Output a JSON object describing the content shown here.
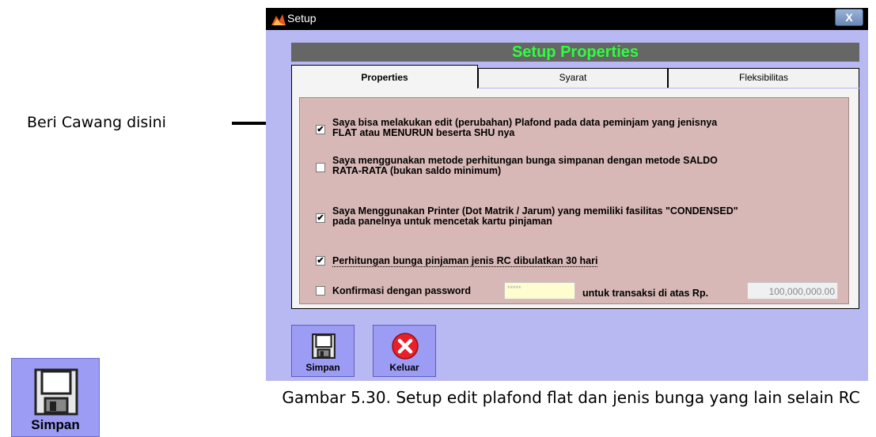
{
  "annotation": {
    "label": "Beri Cawang disini"
  },
  "big_button": {
    "label": "Simpan",
    "icon": "floppy-disk-icon"
  },
  "caption": "Gambar 5.30. Setup edit plafond flat dan jenis bunga yang lain selain RC",
  "window": {
    "title": "Setup",
    "close_label": "X",
    "header": "Setup Properties",
    "tabs": [
      {
        "label": "Properties",
        "active": true
      },
      {
        "label": "Syarat",
        "active": false
      },
      {
        "label": "Fleksibilitas",
        "active": false
      }
    ],
    "options": [
      {
        "checked": true,
        "line1": "Saya bisa melakukan edit (perubahan) Plafond pada data peminjam yang jenisnya",
        "line2": "FLAT atau MENURUN beserta SHU nya"
      },
      {
        "checked": false,
        "line1": "Saya menggunakan metode perhitungan bunga simpanan dengan metode SALDO",
        "line2": "RATA-RATA (bukan saldo minimum)"
      },
      {
        "checked": true,
        "line1": "Saya Menggunakan Printer (Dot Matrik / Jarum) yang memiliki fasilitas \"CONDENSED\"",
        "line2": "pada panelnya untuk mencetak kartu pinjaman"
      },
      {
        "checked": true,
        "line1": "Perhitungan bunga pinjaman jenis RC dibulatkan 30 hari",
        "line2": ""
      }
    ],
    "confirm": {
      "checked": false,
      "label": "Konfirmasi dengan password",
      "password_value": "*****",
      "mid_label": "untuk transaksi di atas Rp.",
      "amount_value": "100,000,000.00"
    },
    "buttons": [
      {
        "label": "Simpan",
        "icon": "floppy-disk-icon"
      },
      {
        "label": "Keluar",
        "icon": "close-circle-icon",
        "color": "#e8202a"
      }
    ]
  }
}
